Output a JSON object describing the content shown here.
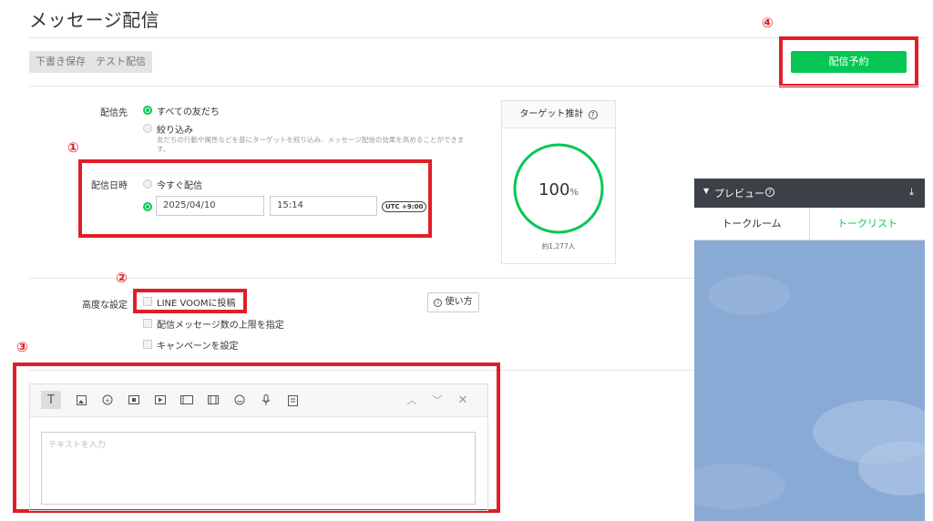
{
  "page": {
    "title": "メッセージ配信"
  },
  "actions": {
    "draft_label": "下書き保存",
    "test_label": "テスト配信",
    "schedule_label": "配信予約"
  },
  "annotations": {
    "n1": "①",
    "n2": "②",
    "n3": "③",
    "n4": "④"
  },
  "recipients": {
    "label": "配信先",
    "all_friends": "すべての友だち",
    "filter": "絞り込み",
    "filter_note_line1": "友だちの行動や属性などを基にターゲットを絞り込み、メッセージ配信の効果を高めることができま",
    "filter_note_line2": "す。"
  },
  "schedule": {
    "label": "配信日時",
    "now": "今すぐ配信",
    "date": "2025/04/10",
    "time": "15:14",
    "timezone": "UTC +9:00"
  },
  "target": {
    "title": "ターゲット推計",
    "info_icon": "info-icon",
    "percent_value": "100",
    "percent_unit": "%",
    "count": "約1,277人",
    "ratio": 1.0
  },
  "advanced": {
    "label": "高度な設定",
    "voom": "LINE VOOMに投稿",
    "limit": "配信メッセージ数の上限を指定",
    "campaign": "キャンペーンを設定",
    "howto": "使い方"
  },
  "editor": {
    "placeholder": "テキストを入力",
    "tools": [
      "text-icon",
      "image-icon",
      "sticker-icon",
      "coupon-icon",
      "video-icon",
      "card-icon",
      "rich-video-icon",
      "emoji-icon",
      "mic-icon",
      "survey-icon"
    ],
    "text_tool_glyph": "T"
  },
  "preview": {
    "title": "プレビュー",
    "tab_room": "トークルーム",
    "tab_list": "トークリスト"
  },
  "colors": {
    "accent": "#06c755",
    "annotation": "#e01e28",
    "preview_header": "#3c4147",
    "preview_bg": "#8aaad6"
  }
}
